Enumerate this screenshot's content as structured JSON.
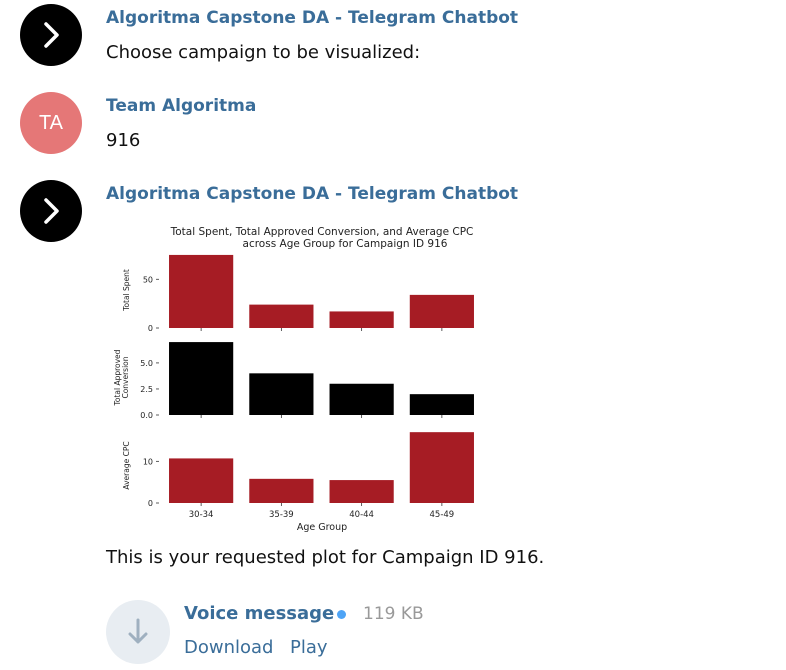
{
  "messages": [
    {
      "sender": "Algoritma Capstone DA - Telegram Chatbot",
      "text": "Choose campaign to be visualized:",
      "avatar": "chevron-right-icon"
    },
    {
      "sender": "Team Algoritma",
      "text": "916",
      "avatar_initials": "TA",
      "avatar_color": "#e57777"
    },
    {
      "sender": "Algoritma Capstone DA - Telegram Chatbot",
      "text": "This is your requested plot for Campaign ID 916.",
      "avatar": "chevron-right-icon"
    }
  ],
  "voice": {
    "title": "Voice message",
    "size": "119 KB",
    "download_label": "Download",
    "play_label": "Play",
    "icon": "download-arrow-icon"
  },
  "colors": {
    "link": "#3a6d99",
    "bar_red": "#a61c24",
    "bar_black": "#000000",
    "dot": "#4ea4f6"
  },
  "chart_data": {
    "type": "bar",
    "title_line1": "Total Spent, Total Approved Conversion, and Average CPC",
    "title_line2": "across Age Group for Campaign ID 916",
    "categories": [
      "30-34",
      "35-39",
      "40-44",
      "45-49"
    ],
    "xlabel": "Age Group",
    "subplots": [
      {
        "ylabel": "Total Spent",
        "values": [
          75,
          24,
          17,
          34
        ],
        "ylim": [
          0,
          78
        ],
        "ticks": [
          0,
          50
        ],
        "tick_labels": [
          "0",
          "50"
        ],
        "color": "#a61c24"
      },
      {
        "ylabel_line1": "Total Approved",
        "ylabel_line2": "Conversion",
        "values": [
          7,
          4,
          3,
          2
        ],
        "ylim": [
          0,
          7.2
        ],
        "ticks": [
          0,
          2.5,
          5
        ],
        "tick_labels": [
          "0.0",
          "2.5",
          "5.0"
        ],
        "color": "#000000"
      },
      {
        "ylabel": "Average CPC",
        "values": [
          10.7,
          5.8,
          5.5,
          17
        ],
        "ylim": [
          0,
          18
        ],
        "ticks": [
          0,
          10
        ],
        "tick_labels": [
          "0",
          "10"
        ],
        "color": "#a61c24"
      }
    ]
  }
}
